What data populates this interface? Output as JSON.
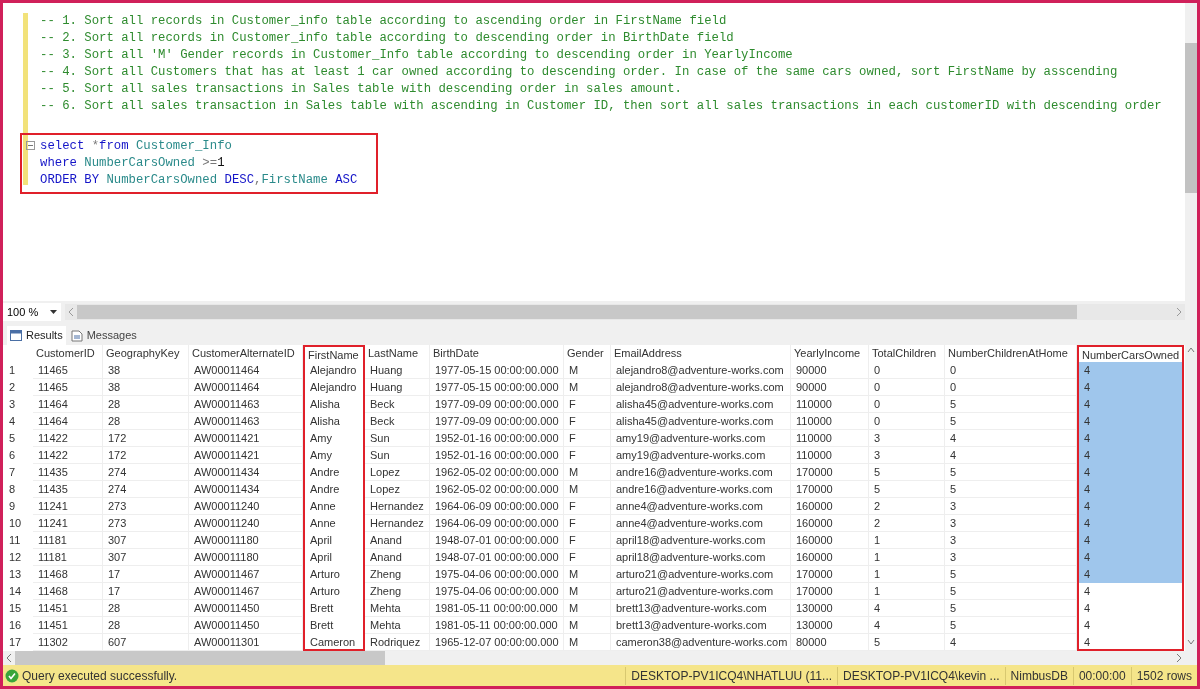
{
  "editor": {
    "comments": [
      "-- 1. Sort all records in Customer_info table according to ascending order in FirstName field",
      "-- 2. Sort all records in Customer_info table according to descending order in BirthDate field",
      "-- 3. Sort all 'M' Gender records in Customer_Info table according to descending order in YearlyIncome",
      "-- 4. Sort all Customers that has at least 1 car owned according to descending order. In case of the same cars owned, sort FirstName by asscending",
      "-- 5. Sort all sales transactions in Sales table with descending order in sales amount.",
      "-- 6. Sort all sales transaction in Sales table with ascending in Customer ID, then sort all sales transactions in each customerID with descending order"
    ],
    "query": {
      "outlined": true,
      "lines": [
        [
          {
            "text": "select",
            "kind": "keyword"
          },
          {
            "text": " *",
            "kind": "operator"
          },
          {
            "text": "from",
            "kind": "keyword"
          },
          {
            "text": " Customer_Info",
            "kind": "identifier"
          }
        ],
        [
          {
            "text": "where",
            "kind": "keyword"
          },
          {
            "text": " NumberCarsOwned",
            "kind": "identifier"
          },
          {
            "text": " >=",
            "kind": "operator"
          },
          {
            "text": "1",
            "kind": "number"
          }
        ],
        [
          {
            "text": "ORDER BY",
            "kind": "keyword"
          },
          {
            "text": " NumberCarsOwned",
            "kind": "identifier"
          },
          {
            "text": " DESC",
            "kind": "keyword"
          },
          {
            "text": ",",
            "kind": "operator"
          },
          {
            "text": "FirstName",
            "kind": "identifier"
          },
          {
            "text": " ASC",
            "kind": "keyword"
          }
        ]
      ]
    }
  },
  "zoom": {
    "value": "100 %"
  },
  "tabs": [
    {
      "label": "Results",
      "selected": true
    },
    {
      "label": "Messages",
      "selected": false
    }
  ],
  "grid": {
    "columns": [
      {
        "label": "CustomerID",
        "outlined": false
      },
      {
        "label": "GeographyKey",
        "outlined": false
      },
      {
        "label": "CustomerAlternateID",
        "outlined": false
      },
      {
        "label": "FirstName",
        "outlined": true
      },
      {
        "label": "LastName",
        "outlined": false
      },
      {
        "label": "BirthDate",
        "outlined": false
      },
      {
        "label": "Gender",
        "outlined": false
      },
      {
        "label": "EmailAddress",
        "outlined": false
      },
      {
        "label": "YearlyIncome",
        "outlined": false
      },
      {
        "label": "TotalChildren",
        "outlined": false
      },
      {
        "label": "NumberChildrenAtHome",
        "outlined": false
      },
      {
        "label": "NumberCarsOwned",
        "outlined": true
      }
    ],
    "rows": [
      {
        "number": "1",
        "selected": true,
        "cells": [
          "11465",
          "38",
          "AW00011464",
          "Alejandro",
          "Huang",
          "1977-05-15 00:00:00.000",
          "M",
          "alejandro8@adventure-works.com",
          "90000",
          "0",
          "0",
          "4"
        ]
      },
      {
        "number": "2",
        "selected": true,
        "cells": [
          "11465",
          "38",
          "AW00011464",
          "Alejandro",
          "Huang",
          "1977-05-15 00:00:00.000",
          "M",
          "alejandro8@adventure-works.com",
          "90000",
          "0",
          "0",
          "4"
        ]
      },
      {
        "number": "3",
        "selected": true,
        "cells": [
          "11464",
          "28",
          "AW00011463",
          "Alisha",
          "Beck",
          "1977-09-09 00:00:00.000",
          "F",
          "alisha45@adventure-works.com",
          "110000",
          "0",
          "5",
          "4"
        ]
      },
      {
        "number": "4",
        "selected": true,
        "cells": [
          "11464",
          "28",
          "AW00011463",
          "Alisha",
          "Beck",
          "1977-09-09 00:00:00.000",
          "F",
          "alisha45@adventure-works.com",
          "110000",
          "0",
          "5",
          "4"
        ]
      },
      {
        "number": "5",
        "selected": true,
        "cells": [
          "11422",
          "172",
          "AW00011421",
          "Amy",
          "Sun",
          "1952-01-16 00:00:00.000",
          "F",
          "amy19@adventure-works.com",
          "110000",
          "3",
          "4",
          "4"
        ]
      },
      {
        "number": "6",
        "selected": true,
        "cells": [
          "11422",
          "172",
          "AW00011421",
          "Amy",
          "Sun",
          "1952-01-16 00:00:00.000",
          "F",
          "amy19@adventure-works.com",
          "110000",
          "3",
          "4",
          "4"
        ]
      },
      {
        "number": "7",
        "selected": true,
        "cells": [
          "11435",
          "274",
          "AW00011434",
          "Andre",
          "Lopez",
          "1962-05-02 00:00:00.000",
          "M",
          "andre16@adventure-works.com",
          "170000",
          "5",
          "5",
          "4"
        ]
      },
      {
        "number": "8",
        "selected": true,
        "cells": [
          "11435",
          "274",
          "AW00011434",
          "Andre",
          "Lopez",
          "1962-05-02 00:00:00.000",
          "M",
          "andre16@adventure-works.com",
          "170000",
          "5",
          "5",
          "4"
        ]
      },
      {
        "number": "9",
        "selected": true,
        "cells": [
          "11241",
          "273",
          "AW00011240",
          "Anne",
          "Hernandez",
          "1964-06-09 00:00:00.000",
          "F",
          "anne4@adventure-works.com",
          "160000",
          "2",
          "3",
          "4"
        ]
      },
      {
        "number": "10",
        "selected": true,
        "cells": [
          "11241",
          "273",
          "AW00011240",
          "Anne",
          "Hernandez",
          "1964-06-09 00:00:00.000",
          "F",
          "anne4@adventure-works.com",
          "160000",
          "2",
          "3",
          "4"
        ]
      },
      {
        "number": "11",
        "selected": true,
        "cells": [
          "11181",
          "307",
          "AW00011180",
          "April",
          "Anand",
          "1948-07-01 00:00:00.000",
          "F",
          "april18@adventure-works.com",
          "160000",
          "1",
          "3",
          "4"
        ]
      },
      {
        "number": "12",
        "selected": true,
        "cells": [
          "11181",
          "307",
          "AW00011180",
          "April",
          "Anand",
          "1948-07-01 00:00:00.000",
          "F",
          "april18@adventure-works.com",
          "160000",
          "1",
          "3",
          "4"
        ]
      },
      {
        "number": "13",
        "selected": true,
        "cells": [
          "11468",
          "17",
          "AW00011467",
          "Arturo",
          "Zheng",
          "1975-04-06 00:00:00.000",
          "M",
          "arturo21@adventure-works.com",
          "170000",
          "1",
          "5",
          "4"
        ]
      },
      {
        "number": "14",
        "selected": false,
        "cells": [
          "11468",
          "17",
          "AW00011467",
          "Arturo",
          "Zheng",
          "1975-04-06 00:00:00.000",
          "M",
          "arturo21@adventure-works.com",
          "170000",
          "1",
          "5",
          "4"
        ]
      },
      {
        "number": "15",
        "selected": false,
        "cells": [
          "11451",
          "28",
          "AW00011450",
          "Brett",
          "Mehta",
          "1981-05-11 00:00:00.000",
          "M",
          "brett13@adventure-works.com",
          "130000",
          "4",
          "5",
          "4"
        ]
      },
      {
        "number": "16",
        "selected": false,
        "cells": [
          "11451",
          "28",
          "AW00011450",
          "Brett",
          "Mehta",
          "1981-05-11 00:00:00.000",
          "M",
          "brett13@adventure-works.com",
          "130000",
          "4",
          "5",
          "4"
        ]
      },
      {
        "number": "17",
        "selected": false,
        "cells": [
          "11302",
          "607",
          "AW00011301",
          "Cameron",
          "Rodriquez",
          "1965-12-07 00:00:00.000",
          "M",
          "cameron38@adventure-works.com",
          "80000",
          "5",
          "4",
          "4"
        ]
      }
    ]
  },
  "status_bar": {
    "message": "Query executed successfully.",
    "panels": [
      "DESKTOP-PV1ICQ4\\NHATLUU (11...",
      "DESKTOP-PV1ICQ4\\kevin ...",
      "NimbusDB",
      "00:00:00",
      "1502 rows"
    ]
  }
}
